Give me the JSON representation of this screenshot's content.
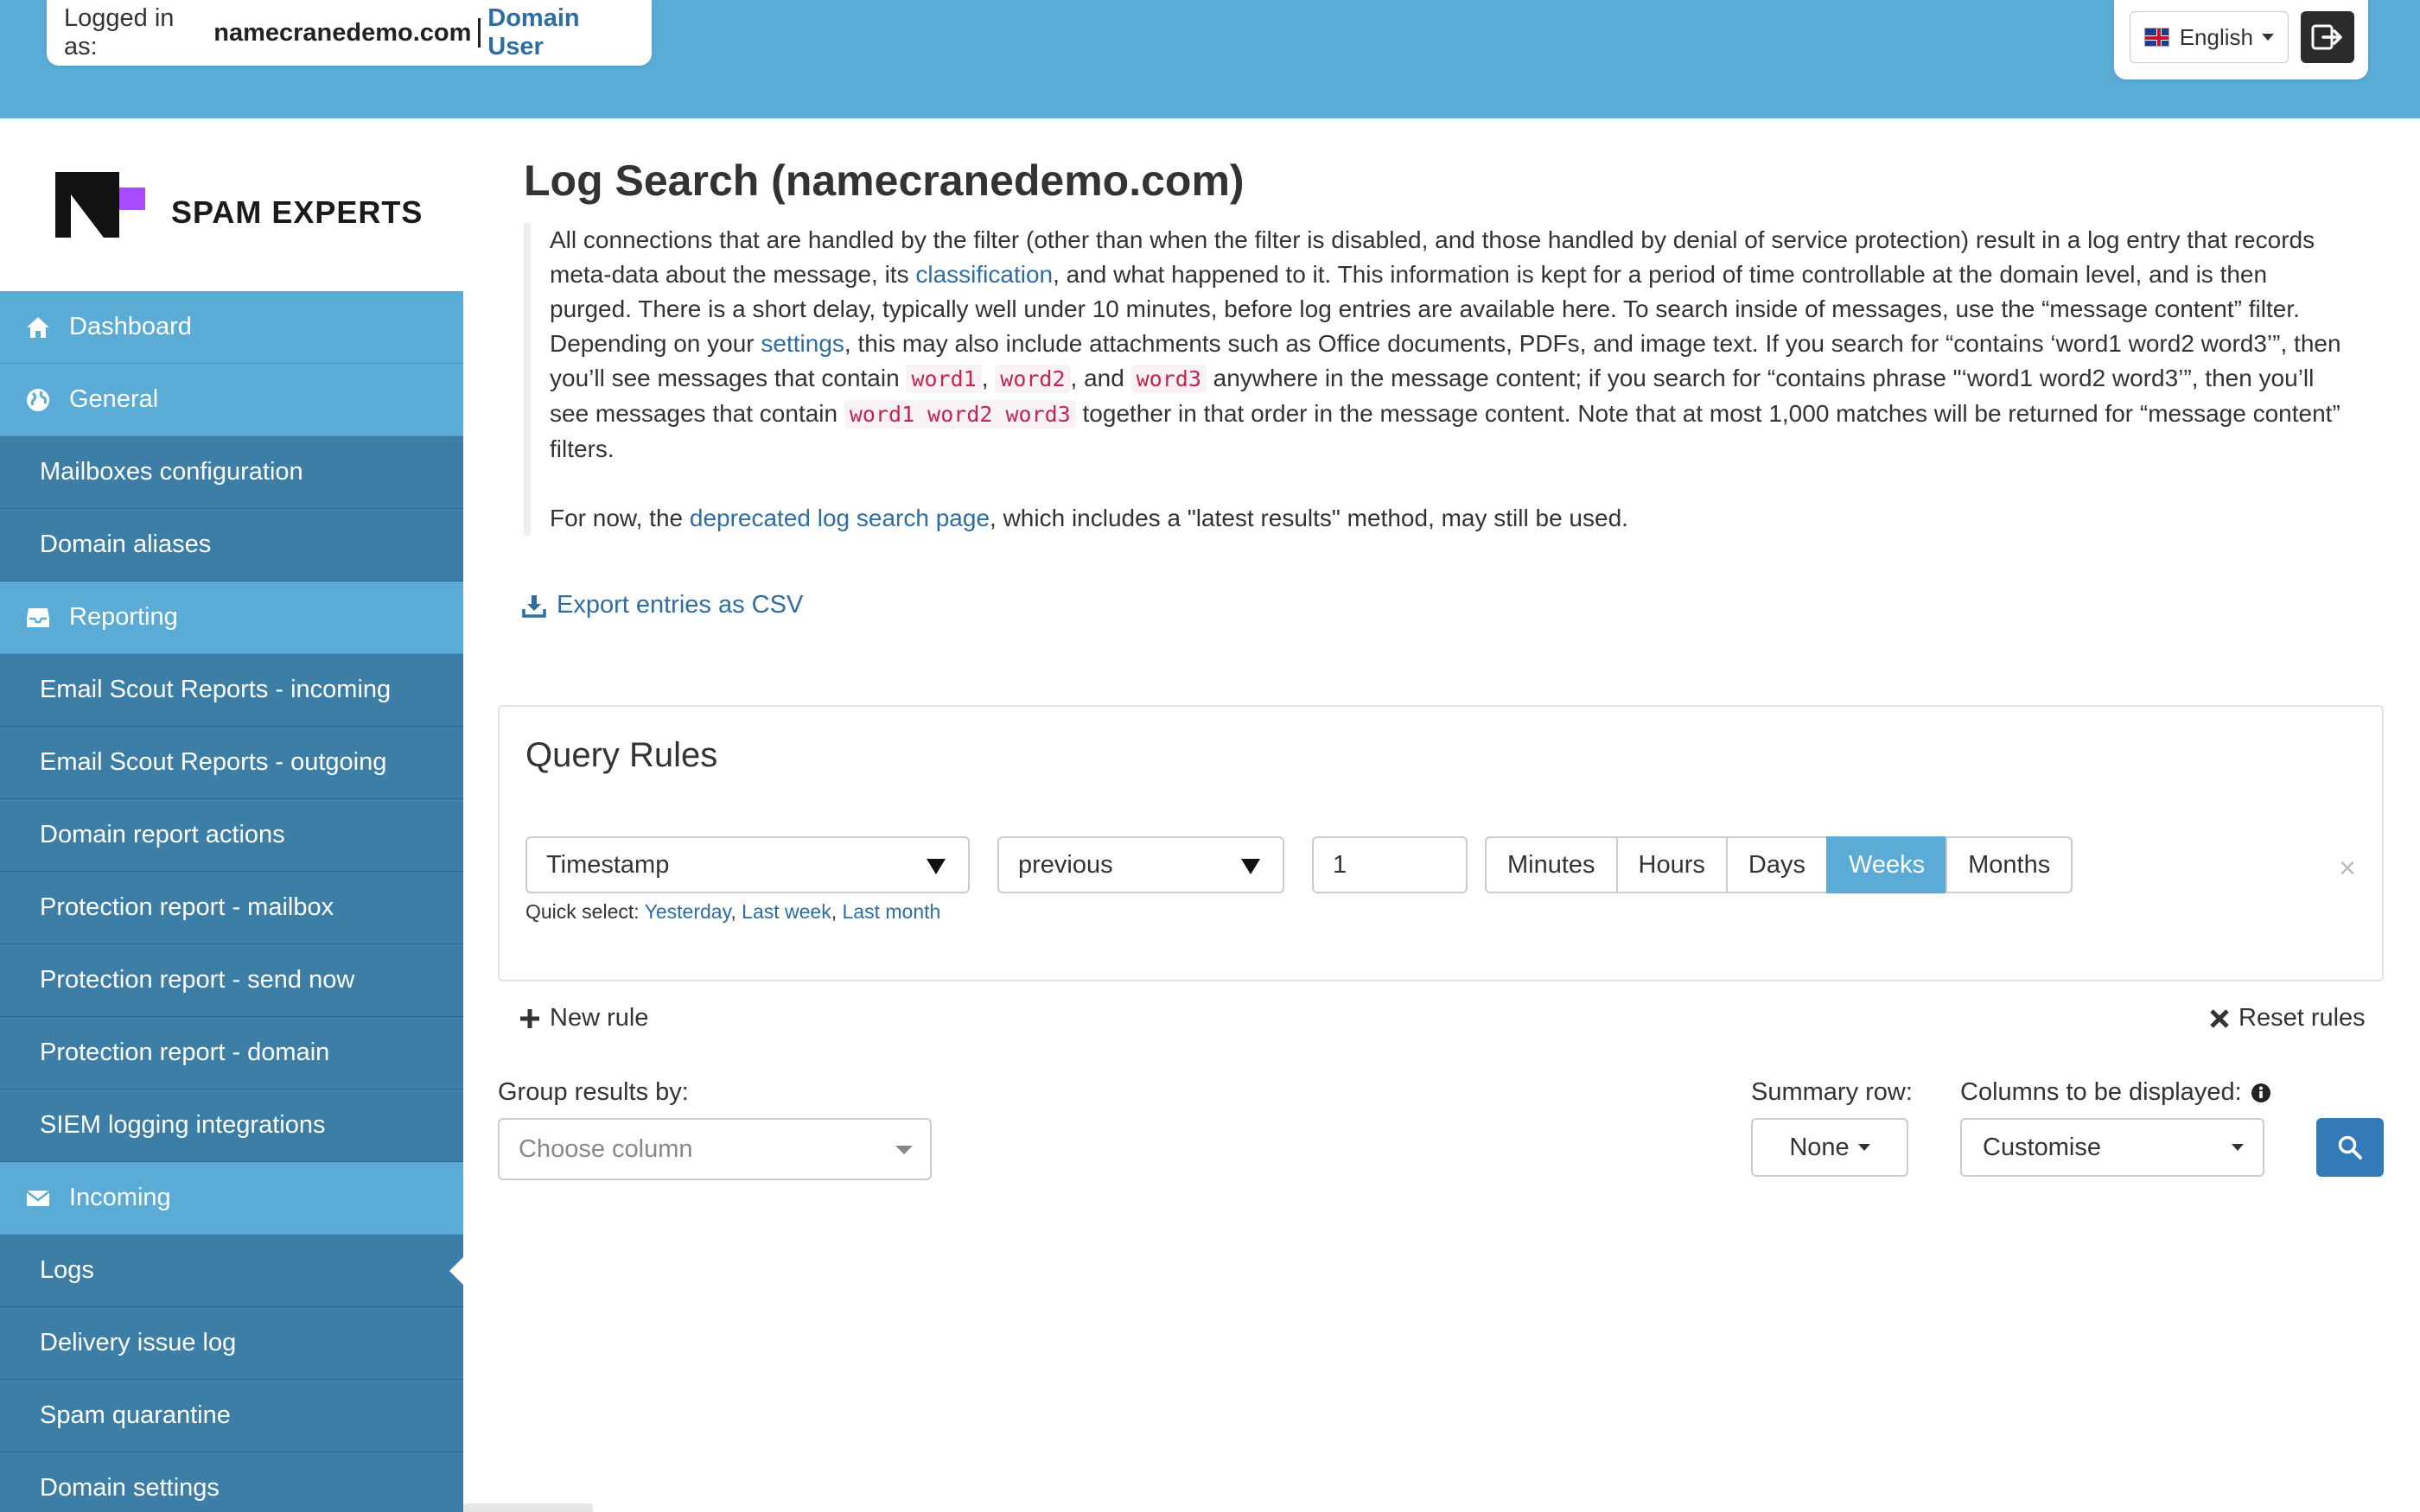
{
  "header": {
    "logged_in_label": "Logged in as:",
    "domain": "namecranedemo.com",
    "role": "Domain User",
    "language": "English"
  },
  "brand": {
    "name": "SPAM EXPERTS"
  },
  "sidebar": {
    "items": [
      {
        "label": "Dashboard",
        "type": "section",
        "icon": "home-icon"
      },
      {
        "label": "General",
        "type": "section",
        "icon": "globe-icon"
      },
      {
        "label": "Mailboxes configuration",
        "type": "sub"
      },
      {
        "label": "Domain aliases",
        "type": "sub"
      },
      {
        "label": "Reporting",
        "type": "section",
        "icon": "inbox-icon"
      },
      {
        "label": "Email Scout Reports - incoming",
        "type": "sub"
      },
      {
        "label": "Email Scout Reports - outgoing",
        "type": "sub"
      },
      {
        "label": "Domain report actions",
        "type": "sub"
      },
      {
        "label": "Protection report - mailbox",
        "type": "sub"
      },
      {
        "label": "Protection report - send now",
        "type": "sub"
      },
      {
        "label": "Protection report - domain",
        "type": "sub"
      },
      {
        "label": "SIEM logging integrations",
        "type": "sub"
      },
      {
        "label": "Incoming",
        "type": "section",
        "icon": "envelope-icon"
      },
      {
        "label": "Logs",
        "type": "sub",
        "active": true
      },
      {
        "label": "Delivery issue log",
        "type": "sub"
      },
      {
        "label": "Spam quarantine",
        "type": "sub"
      },
      {
        "label": "Domain settings",
        "type": "sub"
      }
    ]
  },
  "page": {
    "title": "Log Search (namecranedemo.com)",
    "desc": {
      "t1": "All connections that are handled by the filter (other than when the filter is disabled, and those handled by denial of service protection) result in a log entry that records meta-data about the message, its ",
      "link_classification": "classification",
      "t2": ", and what happened to it. This information is kept for a period of time controllable at the domain level, and is then purged. There is a short delay, typically well under 10 minutes, before log entries are available here. To search inside of messages, use the “message content” filter. Depending on your ",
      "link_settings": "settings",
      "t3": ", this may also include attachments such as Office documents, PDFs, and image text. If you search for “contains ‘word1 word2 word3’”, then you’ll see messages that contain ",
      "code1": "word1",
      "t4": ", ",
      "code2": "word2",
      "t5": ", and ",
      "code3": "word3",
      "t6": " anywhere in the message content; if you search for “contains phrase \"‘word1 word2 word3’”, then you’ll see messages that contain ",
      "code4": "word1 word2 word3",
      "t7": " together in that order in the message content. Note that at most 1,000 matches will be returned for “message content” filters.",
      "p2_t1": "For now, the ",
      "link_deprecated": "deprecated log search page",
      "p2_t2": ", which includes a \"latest results\" method, may still be used."
    },
    "export_label": "Export entries as CSV"
  },
  "query": {
    "title": "Query Rules",
    "field": "Timestamp",
    "operator": "previous",
    "value": "1",
    "units": [
      "Minutes",
      "Hours",
      "Days",
      "Weeks",
      "Months"
    ],
    "active_unit": "Weeks",
    "quick_label": "Quick select:",
    "quick_yesterday": "Yesterday",
    "quick_lastweek": "Last week",
    "quick_lastmonth": "Last month",
    "remove": "×",
    "new_rule": "New rule",
    "reset_rules": "Reset rules"
  },
  "options": {
    "group_label": "Group results by:",
    "group_placeholder": "Choose column",
    "summary_label": "Summary row:",
    "summary_value": "None",
    "columns_label": "Columns to be displayed:",
    "columns_value": "Customise"
  },
  "colors": {
    "topbar": "#5aabd6",
    "sidebar": "#3d7ea6",
    "link": "#2e6da4",
    "primary": "#337ab7"
  }
}
